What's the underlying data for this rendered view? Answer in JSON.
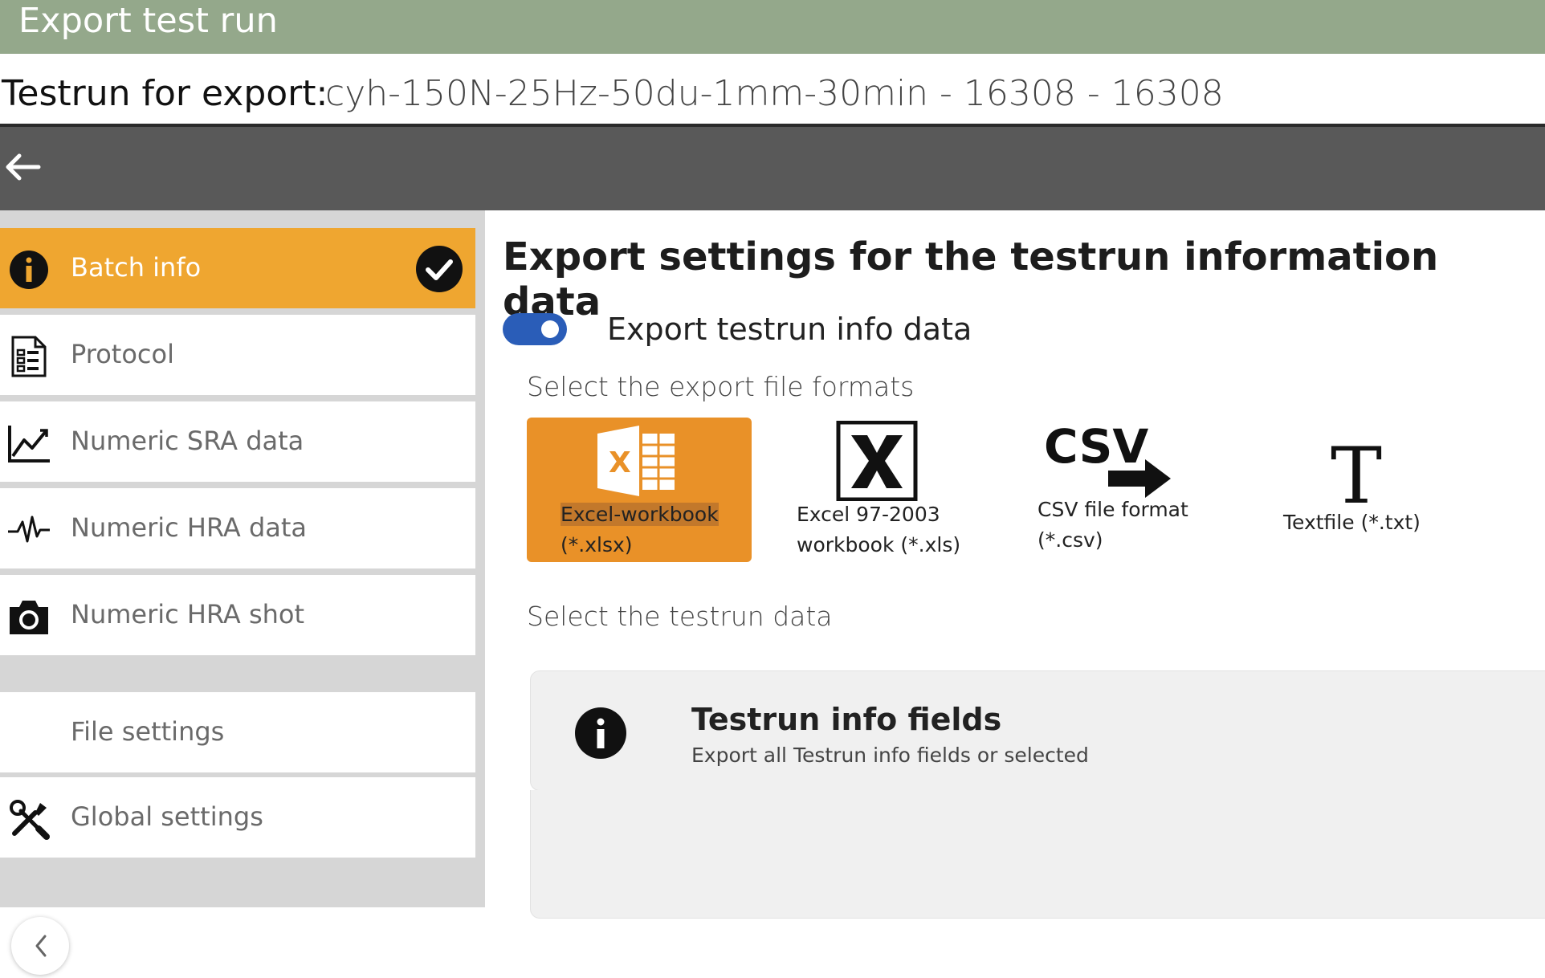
{
  "window": {
    "title": "Export test run"
  },
  "testrun": {
    "label": "Testrun for export:",
    "value": "cyh-150N-25Hz-50du-1mm-30min - 16308  -  16308"
  },
  "sidebar": {
    "items": [
      {
        "label": "Batch info",
        "icon": "info-icon",
        "active": true,
        "checked": true
      },
      {
        "label": "Protocol",
        "icon": "protocol-icon",
        "active": false
      },
      {
        "label": "Numeric SRA data",
        "icon": "line-chart-icon",
        "active": false
      },
      {
        "label": "Numeric HRA data",
        "icon": "pulse-icon",
        "active": false
      },
      {
        "label": "Numeric HRA shot",
        "icon": "camera-icon",
        "active": false
      },
      {
        "label": "File settings",
        "icon": "file-settings-icon",
        "active": false
      },
      {
        "label": "Global settings",
        "icon": "tools-icon",
        "active": false
      }
    ]
  },
  "main": {
    "heading": "Export settings for the testrun information data",
    "toggle": {
      "label": "Export testrun info data",
      "on": true
    },
    "formats_label": "Select the export file formats",
    "formats": [
      {
        "line1": "Excel-workbook",
        "line2": "(*.xlsx)",
        "icon": "excel-xlsx-icon",
        "selected": true
      },
      {
        "line1": "Excel 97-2003",
        "line2": "workbook (*.xls)",
        "icon": "excel-xls-icon",
        "selected": false
      },
      {
        "line1": "CSV file format",
        "line2": "(*.csv)",
        "icon": "csv-icon",
        "selected": false
      },
      {
        "line1": "Textfile (*.txt)",
        "line2": "",
        "icon": "text-icon",
        "selected": false
      }
    ],
    "data_label": "Select the testrun data",
    "card": {
      "title": "Testrun info fields",
      "subtitle": "Export all Testrun info fields or selected"
    }
  },
  "colors": {
    "titlebar": "#94a88b",
    "navbar": "#595959",
    "active": "#efa630",
    "format_selected": "#e99128",
    "toggle": "#2a5db8"
  }
}
